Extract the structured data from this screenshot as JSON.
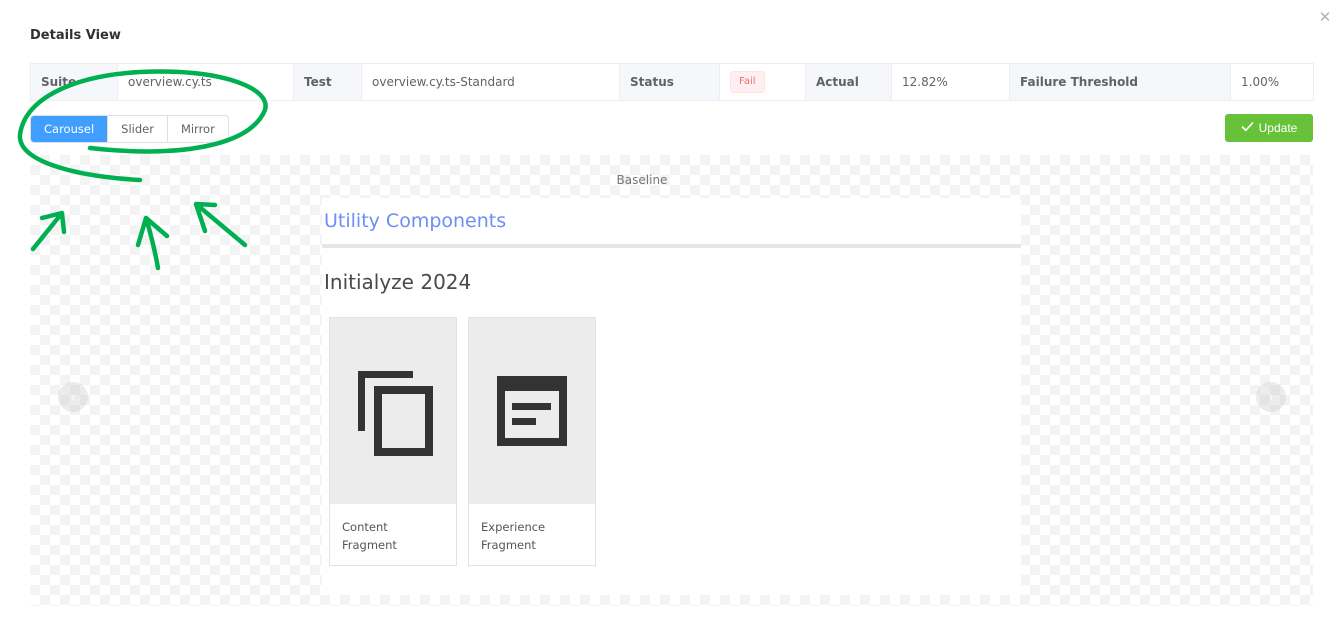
{
  "dialog": {
    "title": "Details View",
    "close_icon": "close-icon"
  },
  "info": {
    "suite_label": "Suite",
    "suite_value": "overview.cy.ts",
    "test_label": "Test",
    "test_value": "overview.cy.ts-Standard",
    "status_label": "Status",
    "status_value": "Fail",
    "actual_label": "Actual",
    "actual_value": "12.82%",
    "threshold_label": "Failure Threshold",
    "threshold_value": "1.00%"
  },
  "modes": {
    "items": [
      {
        "label": "Carousel",
        "active": true
      },
      {
        "label": "Slider",
        "active": false
      },
      {
        "label": "Mirror",
        "active": false
      }
    ]
  },
  "toolbar": {
    "update_label": "Update",
    "update_icon": "check-icon"
  },
  "colors": {
    "primary": "#409eff",
    "success": "#67c23a",
    "danger": "#f56c6c",
    "annotation": "#00b050",
    "link_blue": "#6c8ef5"
  },
  "carousel": {
    "caption": "Baseline",
    "prev_icon": "chevron-left-icon",
    "next_icon": "chevron-right-icon",
    "screenshot": {
      "page_title": "Utility Components",
      "heading": "Initialyze 2024",
      "cards": [
        {
          "label": "Content Fragment",
          "icon": "copy-icon"
        },
        {
          "label": "Experience Fragment",
          "icon": "web-page-icon"
        }
      ]
    }
  }
}
